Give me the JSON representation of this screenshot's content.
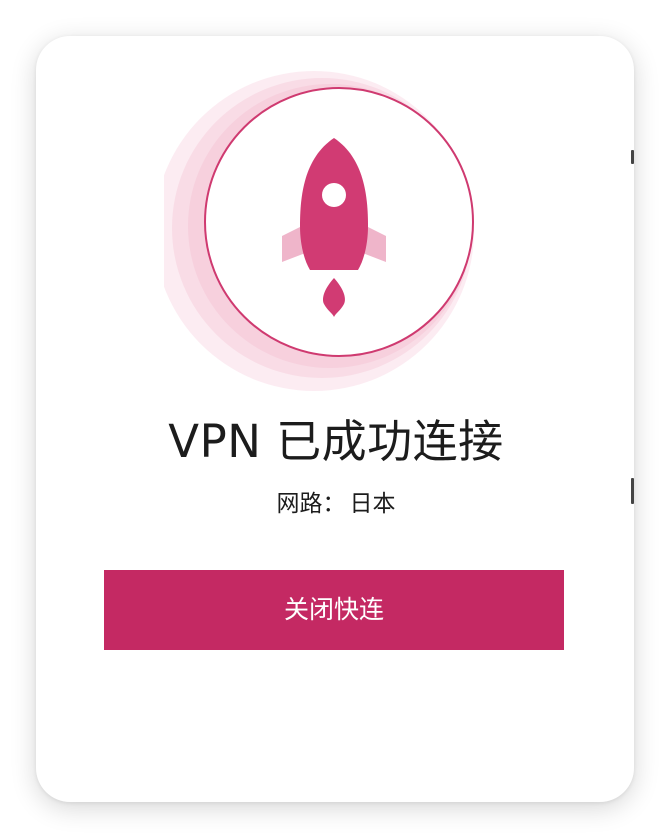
{
  "dialog": {
    "title": "VPN 已成功连接",
    "route_label": "网路：",
    "route_value": "日本",
    "close_button_label": "关闭快连"
  },
  "icons": {
    "emblem": "rocket-icon"
  },
  "colors": {
    "accent": "#c42963",
    "emblem_glow": "#f3c6d6",
    "text": "#1c1c1c",
    "background": "#ffffff"
  }
}
